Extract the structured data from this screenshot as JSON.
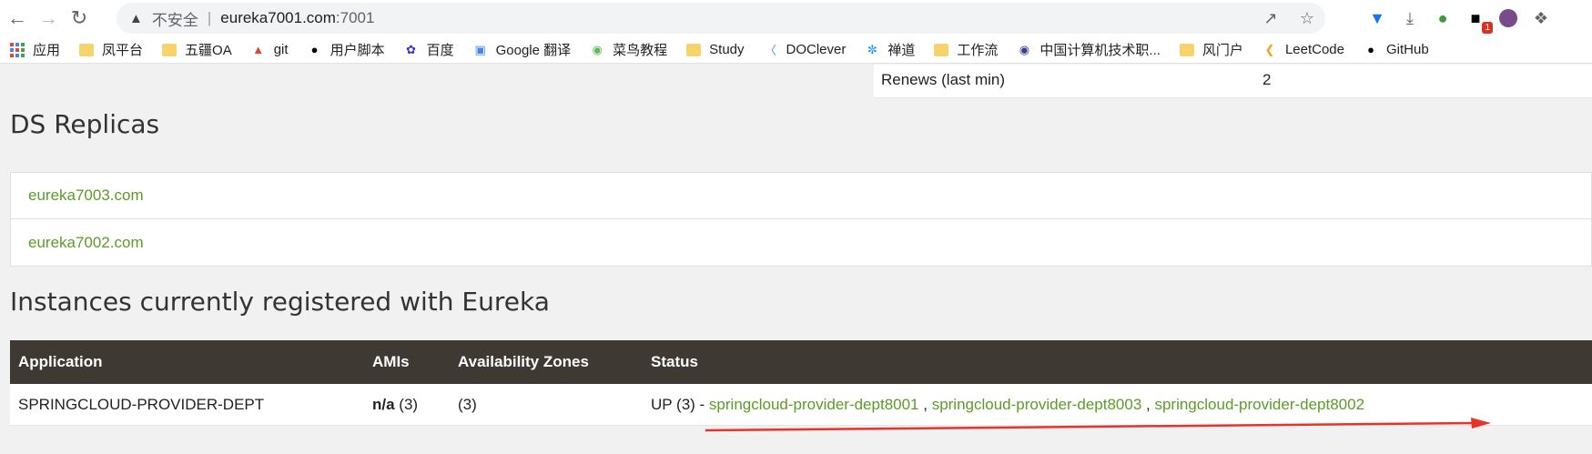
{
  "browser": {
    "security_label": "不安全",
    "separator": "|",
    "url_host": "eureka7001.com",
    "url_port": ":7001",
    "extension_badge": "1",
    "bookmarks": [
      {
        "label": "应用",
        "icon": "apps-grid-icon"
      },
      {
        "label": "凤平台",
        "icon": "folder-icon"
      },
      {
        "label": "五疆OA",
        "icon": "folder-icon"
      },
      {
        "label": "git",
        "icon": "gitlab-icon"
      },
      {
        "label": "用户脚本",
        "icon": "userscript-icon"
      },
      {
        "label": "百度",
        "icon": "baidu-icon"
      },
      {
        "label": "Google 翻译",
        "icon": "google-translate-icon"
      },
      {
        "label": "菜鸟教程",
        "icon": "runoob-icon"
      },
      {
        "label": "Study",
        "icon": "folder-icon"
      },
      {
        "label": "DOClever",
        "icon": "doclever-icon"
      },
      {
        "label": "禅道",
        "icon": "zentao-icon"
      },
      {
        "label": "工作流",
        "icon": "folder-icon"
      },
      {
        "label": "中国计算机技术职...",
        "icon": "ceiaec-icon"
      },
      {
        "label": "风门户",
        "icon": "folder-icon"
      },
      {
        "label": "LeetCode",
        "icon": "leetcode-icon"
      },
      {
        "label": "GitHub",
        "icon": "github-icon"
      }
    ]
  },
  "general_info": {
    "renews_label": "Renews (last min)",
    "renews_value": "2"
  },
  "ds_replicas": {
    "title": "DS Replicas",
    "items": [
      "eureka7003.com",
      "eureka7002.com"
    ]
  },
  "instances": {
    "title": "Instances currently registered with Eureka",
    "headers": [
      "Application",
      "AMIs",
      "Availability Zones",
      "Status"
    ],
    "rows": [
      {
        "application": "SPRINGCLOUD-PROVIDER-DEPT",
        "amis": "n/a (3)",
        "zones": "(3)",
        "status_prefix": "UP (3) - ",
        "status_links": [
          "springcloud-provider-dept8001",
          "springcloud-provider-dept8003",
          "springcloud-provider-dept8002"
        ],
        "link_separator": " , "
      }
    ]
  },
  "colors": {
    "link_green": "#5c9b27",
    "header_dark": "#3e3a33",
    "annotation_arrow": "#e8322b"
  }
}
